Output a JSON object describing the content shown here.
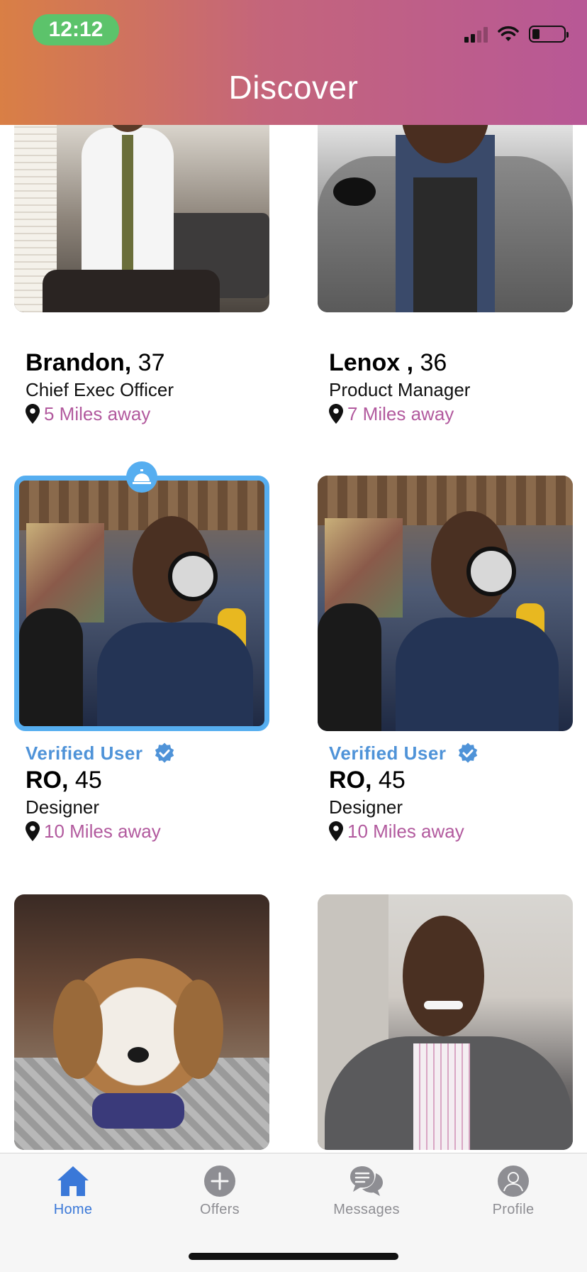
{
  "status_bar": {
    "time": "12:12"
  },
  "header": {
    "title": "Discover"
  },
  "cards": [
    {
      "name": "Brandon,",
      "age": "37",
      "title": "Chief Exec Officer",
      "distance": "5 Miles away"
    },
    {
      "name": "Lenox ,",
      "age": "36",
      "title": "Product  Manager",
      "distance": "7 Miles away"
    },
    {
      "verified_label": "Verified User",
      "name": "RO,",
      "age": "45",
      "title": "Designer",
      "distance": "10 Miles away",
      "highlighted": true
    },
    {
      "verified_label": "Verified User",
      "name": "RO,",
      "age": "45",
      "title": "Designer",
      "distance": "10 Miles away"
    }
  ],
  "tabbar": {
    "items": [
      {
        "label": "Home",
        "icon": "home-icon",
        "active": true
      },
      {
        "label": "Offers",
        "icon": "plus-circle-icon"
      },
      {
        "label": "Messages",
        "icon": "chat-bubbles-icon"
      },
      {
        "label": "Profile",
        "icon": "person-icon"
      }
    ]
  },
  "colors": {
    "header_gradient_start": "#d97f45",
    "header_gradient_end": "#b85896",
    "time_pill": "#5cc36b",
    "verified_blue": "#4f93d8",
    "distance_pink": "#b25a9e",
    "highlight_border": "#56aef0",
    "active_tab": "#3a78d8",
    "inactive_tab": "#8e8e93"
  }
}
